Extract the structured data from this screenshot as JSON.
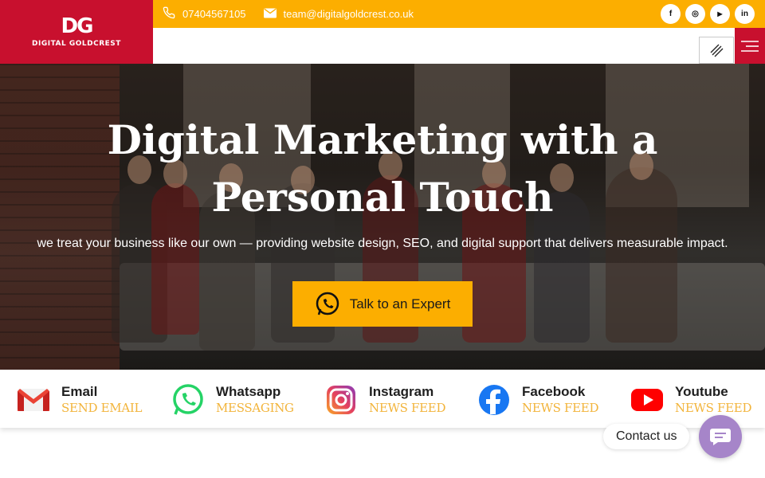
{
  "brand": {
    "logo_mark": "DG",
    "logo_text": "DIGITAL GOLDCREST"
  },
  "topbar": {
    "phone": "07404567105",
    "email": "team@digitalgoldcrest.co.uk",
    "socials": [
      "facebook-icon",
      "instagram-icon",
      "youtube-icon",
      "linkedin-icon"
    ],
    "social_glyphs": [
      "f",
      "◎",
      "▶",
      "in"
    ]
  },
  "hero": {
    "title": "Digital Marketing with a Personal Touch",
    "subtitle": "we treat your business like our own — providing website design, SEO, and digital support that delivers measurable impact.",
    "cta_label": "Talk to an Expert"
  },
  "channels": [
    {
      "name": "Email",
      "sub": "SEND EMAIL",
      "icon": "gmail-icon"
    },
    {
      "name": "Whatsapp",
      "sub": "MESSAGING",
      "icon": "whatsapp-icon"
    },
    {
      "name": "Instagram",
      "sub": "NEWS FEED",
      "icon": "instagram-icon"
    },
    {
      "name": "Facebook",
      "sub": "NEWS FEED",
      "icon": "facebook-icon"
    },
    {
      "name": "Youtube",
      "sub": "NEWS FEED",
      "icon": "youtube-icon"
    }
  ],
  "contact_widget": {
    "label": "Contact us"
  },
  "colors": {
    "brand_red": "#c8102e",
    "accent_yellow": "#fcae00",
    "sub_text_gold": "#f2b43b",
    "widget_purple": "#a685c9"
  }
}
